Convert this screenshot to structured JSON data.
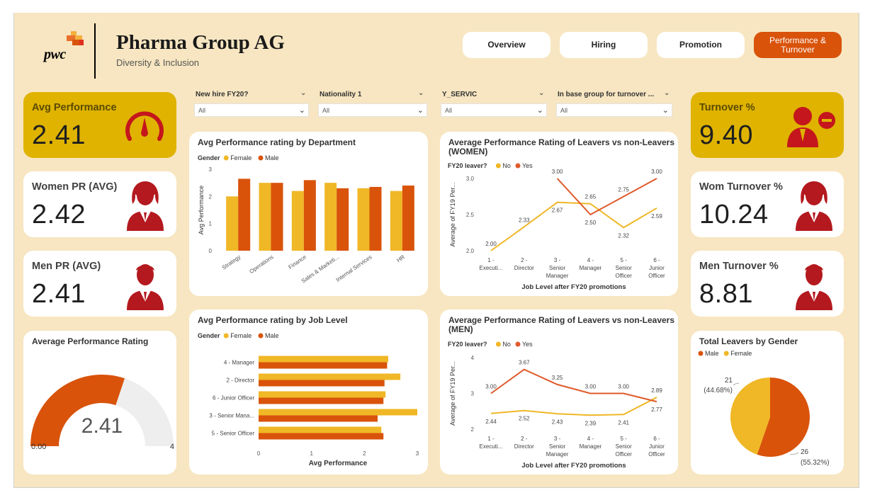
{
  "header": {
    "logo_text": "pwc",
    "title": "Pharma Group AG",
    "subtitle": "Diversity & Inclusion"
  },
  "nav": {
    "overview": "Overview",
    "hiring": "Hiring",
    "promotion": "Promotion",
    "performance": "Performance & Turnover"
  },
  "slicers": [
    {
      "label": "New hire FY20?",
      "value": "All"
    },
    {
      "label": "Nationality 1",
      "value": "All"
    },
    {
      "label": "Y_SERVIC",
      "value": "All"
    },
    {
      "label": "In base group for turnover ...",
      "value": "All"
    }
  ],
  "kpis": {
    "avg_performance": {
      "label": "Avg Performance",
      "value": "2.41"
    },
    "women_pr": {
      "label": "Women PR (AVG)",
      "value": "2.42"
    },
    "men_pr": {
      "label": "Men PR (AVG)",
      "value": "2.41"
    },
    "turnover": {
      "label": "Turnover %",
      "value": "9.40"
    },
    "wom_turnover": {
      "label": "Wom Turnover %",
      "value": "10.24"
    },
    "men_turnover": {
      "label": "Men Turnover %",
      "value": "8.81"
    }
  },
  "gauge": {
    "title": "Average Performance Rating",
    "value_label": "2.41",
    "min_label": "0.00",
    "max_label": "4",
    "value": 2.41,
    "min": 0,
    "max": 4,
    "fill_color": "#d9530b",
    "track_color": "#eeeeee"
  },
  "colors": {
    "female": "#f0b726",
    "male": "#d9530b",
    "no": "#f0b726",
    "yes": "#e05a2b"
  },
  "chart_data": [
    {
      "type": "bar",
      "title": "Avg Performance rating by Department",
      "legend_title": "Gender",
      "categories": [
        "Strategy",
        "Operations",
        "Finance",
        "Sales & Marketi...",
        "Internal Services",
        "HR"
      ],
      "series": [
        {
          "name": "Female",
          "values": [
            2.0,
            2.5,
            2.2,
            2.5,
            2.3,
            2.2
          ]
        },
        {
          "name": "Male",
          "values": [
            2.65,
            2.5,
            2.6,
            2.3,
            2.35,
            2.4
          ]
        }
      ],
      "ylabel": "Avg Performance",
      "ylim": [
        0,
        3
      ],
      "yticks": [
        "0",
        "1",
        "2",
        "3"
      ],
      "legend_position": "top-left"
    },
    {
      "type": "bar",
      "orientation": "horizontal",
      "title": "Avg Performance rating by Job Level",
      "legend_title": "Gender",
      "categories": [
        "4 - Manager",
        "2 - Director",
        "6 - Junior Officer",
        "3 - Senior Mana...",
        "5 - Senior Officer"
      ],
      "series": [
        {
          "name": "Female",
          "values": [
            2.45,
            2.68,
            2.4,
            3.0,
            2.32
          ]
        },
        {
          "name": "Male",
          "values": [
            2.43,
            2.38,
            2.36,
            2.25,
            2.36
          ]
        }
      ],
      "xlabel": "Avg Performance",
      "xlim": [
        0,
        3
      ],
      "xticks": [
        "0",
        "1",
        "2",
        "3"
      ],
      "legend_position": "top-left"
    },
    {
      "type": "line",
      "title": "Average Performance Rating of Leavers vs non-Leavers (WOMEN)",
      "legend_title": "FY20 leaver?",
      "categories": [
        "1 - Executi...",
        "2 - Director",
        "3 - Senior Manager",
        "4 - Manager",
        "5 - Senior Officer",
        "6 - Junior Officer"
      ],
      "series": [
        {
          "name": "No",
          "values": [
            2.0,
            2.33,
            2.67,
            2.65,
            2.32,
            2.59
          ],
          "labels": [
            "2.00",
            "2.33",
            "2.67",
            "2.65",
            "2.32",
            "2.59"
          ]
        },
        {
          "name": "Yes",
          "values": [
            null,
            null,
            3.0,
            2.5,
            2.75,
            3.0
          ],
          "labels": [
            "",
            "",
            "3.00",
            "2.50",
            "2.75",
            "3.00"
          ]
        }
      ],
      "xlabel": "Job Level after FY20 promotions",
      "ylabel": "Average of FY19 Per...",
      "ylim": [
        2.0,
        3.0
      ],
      "yticks": [
        "2.0",
        "2.5",
        "3.0"
      ],
      "legend_position": "top-left"
    },
    {
      "type": "line",
      "title": "Average Performance Rating of Leavers vs non-Leavers (MEN)",
      "legend_title": "FY20 leaver?",
      "categories": [
        "1 - Executi...",
        "2 - Director",
        "3 - Senior Manager",
        "4 - Manager",
        "5 - Senior Officer",
        "6 - Junior Officer"
      ],
      "series": [
        {
          "name": "No",
          "values": [
            2.44,
            2.52,
            2.43,
            2.39,
            2.41,
            2.89
          ],
          "labels": [
            "2.44",
            "2.52",
            "2.43",
            "2.39",
            "2.41",
            "2.89"
          ]
        },
        {
          "name": "Yes",
          "values": [
            3.0,
            3.67,
            3.25,
            3.0,
            3.0,
            2.77
          ],
          "labels": [
            "3.00",
            "3.67",
            "3.25",
            "3.00",
            "3.00",
            "2.77"
          ]
        }
      ],
      "xlabel": "Job Level after FY20 promotions",
      "ylabel": "Average of FY19 Per...",
      "ylim": [
        2,
        4
      ],
      "yticks": [
        "2",
        "3",
        "4"
      ],
      "legend_position": "top-left"
    },
    {
      "type": "pie",
      "title": "Total Leavers by Gender",
      "categories": [
        "Male",
        "Female"
      ],
      "values": [
        26,
        21
      ],
      "labels": [
        "26",
        "21"
      ],
      "percent_labels": [
        "(55.32%)",
        "(44.68%)"
      ],
      "legend_position": "top-left"
    }
  ]
}
